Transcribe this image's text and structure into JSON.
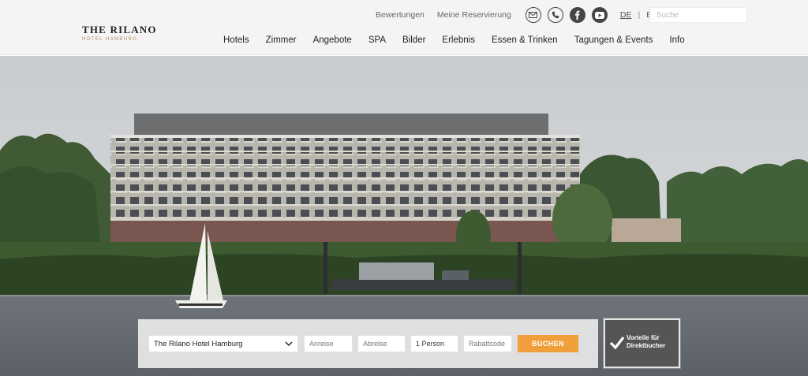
{
  "brand": {
    "name": "THE RILANO",
    "subtitle": "HOTEL HAMBURG"
  },
  "topbar": {
    "links": [
      "Bewertungen",
      "Meine Reservierung"
    ],
    "social": [
      "mail-icon",
      "phone-icon",
      "facebook-icon",
      "youtube-icon"
    ],
    "lang_active": "DE",
    "lang_sep": "|",
    "lang_other": "EN",
    "search_placeholder": "Suche"
  },
  "nav": [
    "Hotels",
    "Zimmer",
    "Angebote",
    "SPA",
    "Bilder",
    "Erlebnis",
    "Essen & Trinken",
    "Tagungen & Events",
    "Info"
  ],
  "booking": {
    "hotel": "The Rilano Hotel Hamburg",
    "arrival_placeholder": "Anreise",
    "departure_placeholder": "Abreise",
    "guests": "1 Person",
    "promo_placeholder": "Rabattcode",
    "book_label": "BUCHEN"
  },
  "vorteile": {
    "line1": "Vorteile für",
    "line2": "Direktbucher"
  },
  "colors": {
    "accent": "#f0a03a",
    "header_bg": "#f4f4f4",
    "badge_bg": "#555555"
  }
}
